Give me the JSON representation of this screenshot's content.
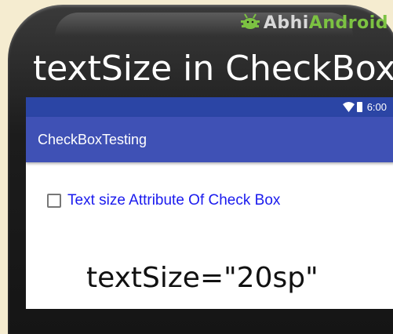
{
  "logo": {
    "part1": "Abhi",
    "part2": "Android"
  },
  "overlay_title": "textSize in CheckBox",
  "status_bar": {
    "time": "6:00",
    "wifi_icon": "wifi-icon",
    "battery_icon": "battery-icon"
  },
  "app_bar": {
    "title": "CheckBoxTesting"
  },
  "checkbox": {
    "label": "Text size Attribute Of Check Box",
    "checked": false
  },
  "caption": "textSize=\"20sp\"",
  "colors": {
    "status_bar": "#2b45a5",
    "action_bar": "#3f51b5",
    "checkbox_text": "#1a1aee",
    "logo_green": "#7cc242"
  }
}
